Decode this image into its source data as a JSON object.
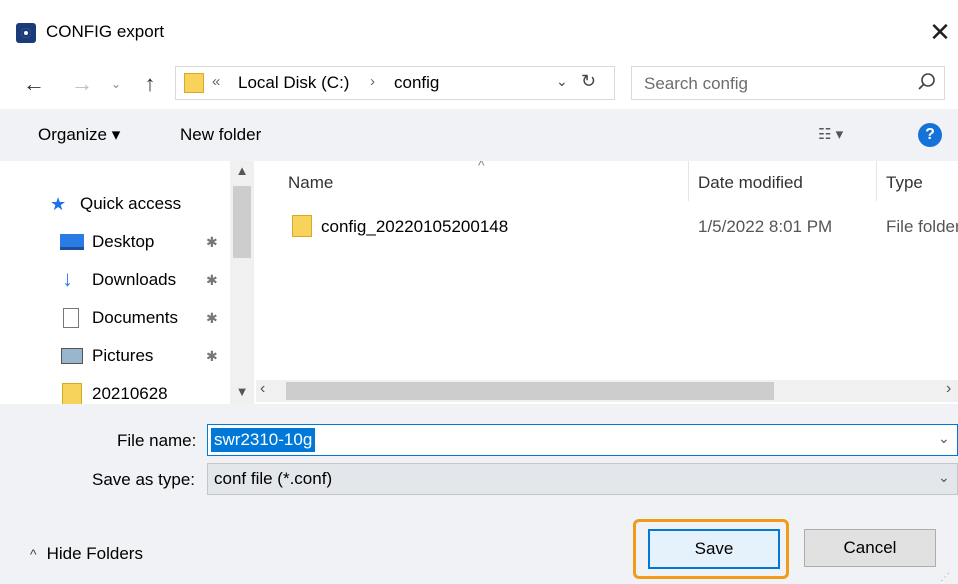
{
  "window": {
    "title": "CONFIG export",
    "close_glyph": "✕"
  },
  "nav": {
    "back_glyph": "←",
    "forward_glyph": "→",
    "recent_glyph": "⌄",
    "up_glyph": "↑"
  },
  "address": {
    "overflow_glyph": "«",
    "crumbs": [
      "Local Disk (C:)",
      "config"
    ],
    "separator_glyph": "›",
    "dropdown_glyph": "⌄",
    "refresh_glyph": "↻"
  },
  "search": {
    "placeholder": "Search config",
    "value": ""
  },
  "toolbar": {
    "organize_label": "Organize ▾",
    "new_folder_label": "New folder",
    "view_glyph": "☷ ▾",
    "help_glyph": "?"
  },
  "sidebar": {
    "items": [
      {
        "label": "Quick access",
        "icon": "star-icon"
      },
      {
        "label": "Desktop",
        "icon": "desktop-icon",
        "pinned": true
      },
      {
        "label": "Downloads",
        "icon": "download-icon",
        "pinned": true
      },
      {
        "label": "Documents",
        "icon": "documents-icon",
        "pinned": true
      },
      {
        "label": "Pictures",
        "icon": "pictures-icon",
        "pinned": true
      },
      {
        "label": "20210628",
        "icon": "folder-icon"
      }
    ],
    "pin_glyph": "📌",
    "scroll_up_glyph": "▲",
    "scroll_down_glyph": "▼"
  },
  "filelist": {
    "columns": [
      "Name",
      "Date modified",
      "Type"
    ],
    "sort_glyph": "^",
    "rows": [
      {
        "name": "config_20220105200148",
        "date": "1/5/2022 8:01 PM",
        "type": "File folder"
      }
    ],
    "hscroll_left": "‹",
    "hscroll_right": "›"
  },
  "form": {
    "file_name_label": "File name:",
    "file_name_value": "swr2310-10g",
    "save_type_label": "Save as type:",
    "save_type_value": "conf file (*.conf)",
    "caret_glyph": "⌄"
  },
  "footer": {
    "hide_folders_label": "Hide Folders",
    "hide_folders_glyph": "^",
    "save_label": "Save",
    "cancel_label": "Cancel"
  },
  "colors": {
    "accent": "#0078d7",
    "highlight": "#f29a1c",
    "folder": "#f7d35c"
  }
}
